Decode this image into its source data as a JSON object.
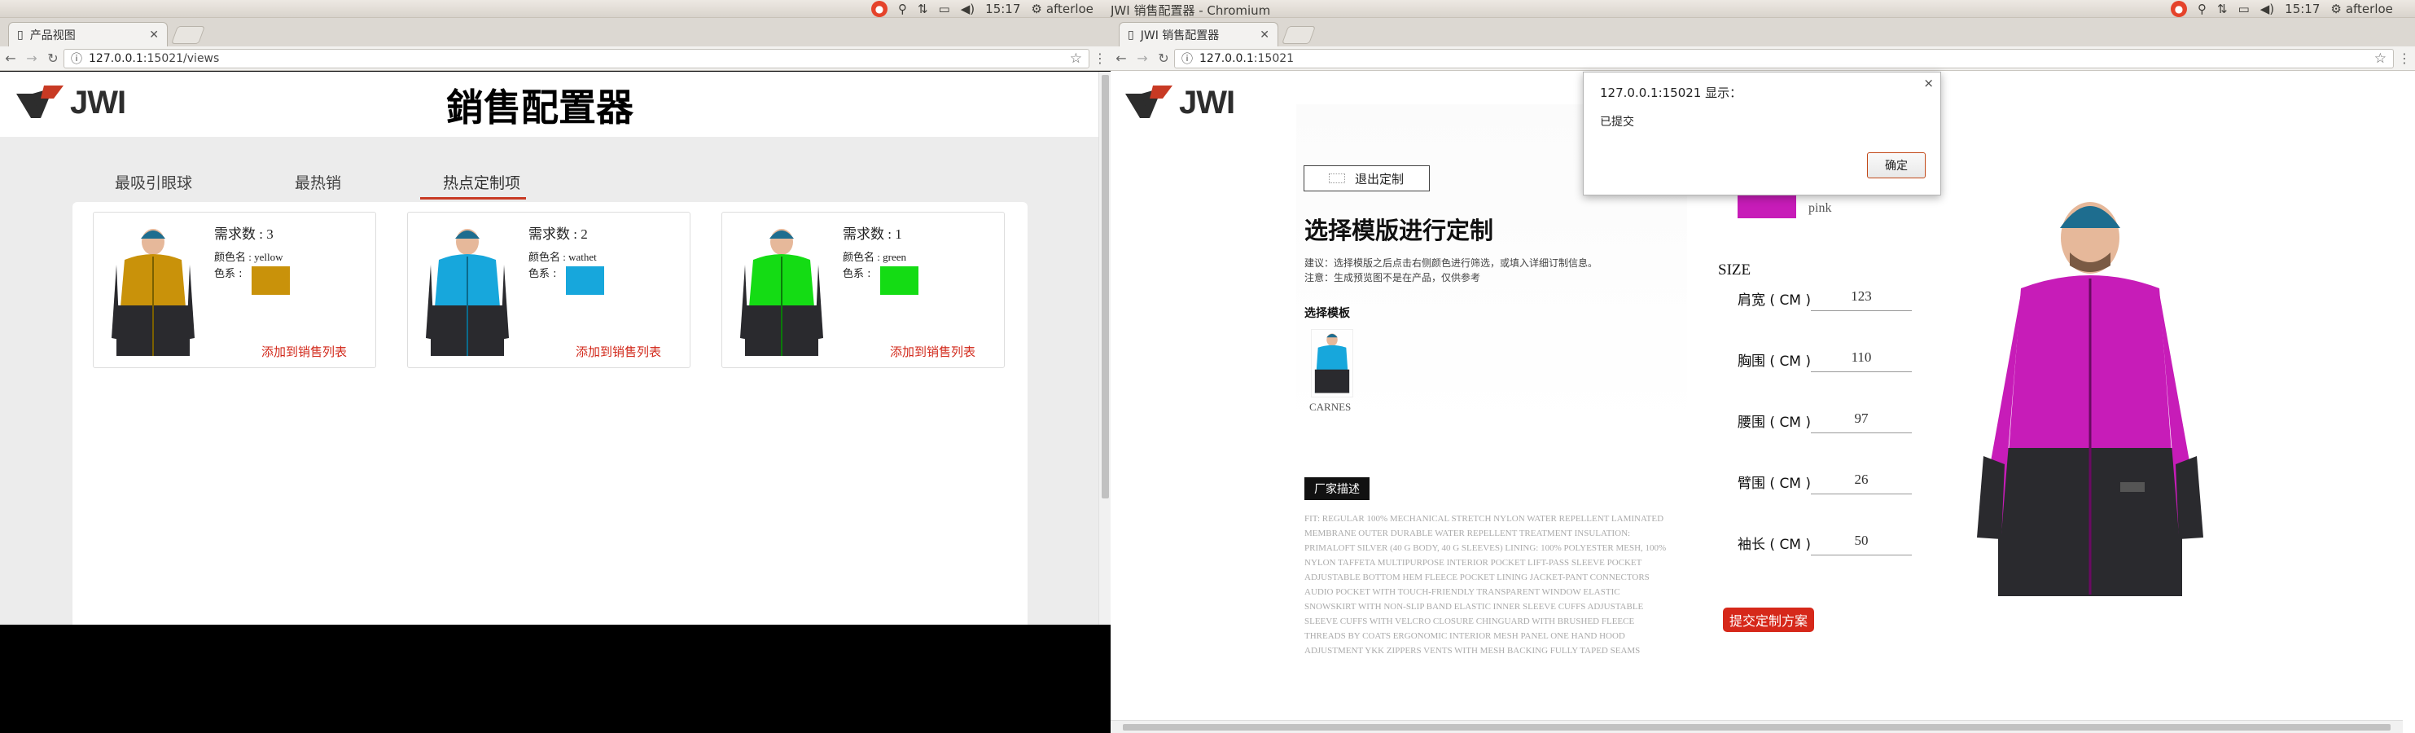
{
  "left": {
    "tab_title": "产品视图",
    "url_host": "127.0.0.1",
    "url_rest": ":15021/views",
    "clock": "15:17",
    "user": "afterloe",
    "logo_text": "JWI",
    "page_title": "銷售配置器",
    "tabs": [
      {
        "label": "最吸引眼球"
      },
      {
        "label": "最热销"
      },
      {
        "label": "热点定制项"
      }
    ],
    "cards": [
      {
        "demand": "需求数 : 3",
        "color_name": "颜色名 : yellow",
        "color_label": "色系 :",
        "color": "#c9920a",
        "add": "添加到销售列表"
      },
      {
        "demand": "需求数 : 2",
        "color_name": "颜色名 : wathet",
        "color_label": "色系 :",
        "color": "#17a7dc",
        "add": "添加到销售列表"
      },
      {
        "demand": "需求数 : 1",
        "color_name": "颜色名 : green",
        "color_label": "色系 :",
        "color": "#14dc14",
        "add": "添加到销售列表"
      }
    ]
  },
  "right": {
    "window_title": "JWI 销售配置器 - Chromium",
    "tab_title": "JWI 销售配置器",
    "url_host": "127.0.0.1",
    "url_rest": ":15021",
    "clock": "15:17",
    "user": "afterloe",
    "logo_text": "JWI",
    "exit_label": "退出定制",
    "heading": "选择模版进行定制",
    "note1": "建议：选择模版之后点击右侧颜色进行筛选，或填入详细订制信息。",
    "note2": "注意：生成预览图不是在产品，仅供参考",
    "choose_label": "选择模板",
    "template_caption": "CARNES",
    "desc_button": "厂家描述",
    "description": "FIT: REGULAR 100% MECHANICAL STRETCH NYLON WATER REPELLENT LAMINATED MEMBRANE OUTER DURABLE WATER REPELLENT TREATMENT INSULATION: PRIMALOFT SILVER (40 G BODY, 40 G SLEEVES) LINING: 100% POLYESTER MESH, 100% NYLON TAFFETA MULTIPURPOSE INTERIOR POCKET LIFT-PASS SLEEVE POCKET ADJUSTABLE BOTTOM HEM FLEECE POCKET LINING JACKET-PANT CONNECTORS AUDIO POCKET WITH TOUCH-FRIENDLY TRANSPARENT WINDOW ELASTIC SNOWSKIRT WITH NON-SLIP BAND ELASTIC INNER SLEEVE CUFFS ADJUSTABLE SLEEVE CUFFS WITH VELCRO CLOSURE CHINGUARD WITH BRUSHED FLEECE THREADS BY COATS ERGONOMIC INTERIOR MESH PANEL ONE HAND HOOD ADJUSTMENT YKK ZIPPERS VENTS WITH MESH BACKING FULLY TAPED SEAMS",
    "selected_color_name": "pink",
    "selected_color": "#c71cb8",
    "size_title": "SIZE",
    "sizes": [
      {
        "label": "肩宽 ( CM )",
        "value": "123"
      },
      {
        "label": "胸围 ( CM )",
        "value": "110"
      },
      {
        "label": "腰围 ( CM )",
        "value": "97"
      },
      {
        "label": "臂围 ( CM )",
        "value": "26"
      },
      {
        "label": "袖长 ( CM )",
        "value": "50"
      }
    ],
    "submit_label": "提交定制方案",
    "dialog": {
      "title": "127.0.0.1:15021 显示：",
      "message": "已提交",
      "ok": "确定",
      "close": "×"
    }
  }
}
